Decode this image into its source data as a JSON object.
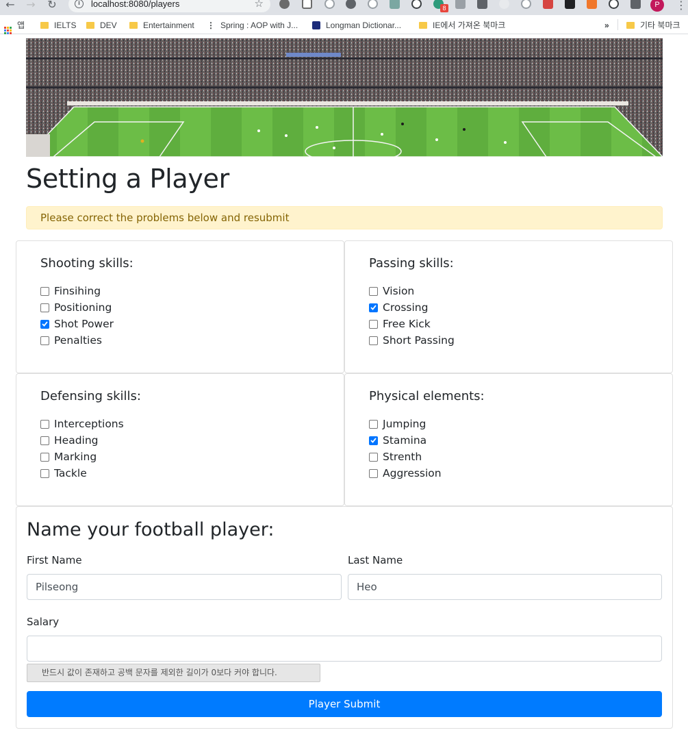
{
  "browser": {
    "url": "localhost:8080/players",
    "profile_initial": "P",
    "extension_badge": "8",
    "bookmarks": [
      {
        "label": "앱",
        "icon": "apps-icon"
      },
      {
        "label": "IELTS",
        "icon": "folder-icon"
      },
      {
        "label": "DEV",
        "icon": "folder-icon"
      },
      {
        "label": "Entertainment",
        "icon": "folder-icon"
      },
      {
        "label": "Spring : AOP with J...",
        "icon": "site-icon"
      },
      {
        "label": "Longman Dictionar...",
        "icon": "site-icon"
      },
      {
        "label": "IE에서 가져온 북마크",
        "icon": "folder-icon"
      },
      {
        "label": "기타 북마크",
        "icon": "folder-icon"
      }
    ],
    "overflow_label": "»"
  },
  "page": {
    "title": "Setting a Player",
    "alert": "Please correct the problems below and resubmit"
  },
  "skills": {
    "shooting": {
      "title": "Shooting skills:",
      "items": [
        {
          "label": "Finsihing",
          "checked": false
        },
        {
          "label": "Positioning",
          "checked": false
        },
        {
          "label": "Shot Power",
          "checked": true
        },
        {
          "label": "Penalties",
          "checked": false
        }
      ]
    },
    "passing": {
      "title": "Passing skills:",
      "items": [
        {
          "label": "Vision",
          "checked": false
        },
        {
          "label": "Crossing",
          "checked": true
        },
        {
          "label": "Free Kick",
          "checked": false
        },
        {
          "label": "Short Passing",
          "checked": false
        }
      ]
    },
    "defensing": {
      "title": "Defensing skills:",
      "items": [
        {
          "label": "Interceptions",
          "checked": false
        },
        {
          "label": "Heading",
          "checked": false
        },
        {
          "label": "Marking",
          "checked": false
        },
        {
          "label": "Tackle",
          "checked": false
        }
      ]
    },
    "physical": {
      "title": "Physical elements:",
      "items": [
        {
          "label": "Jumping",
          "checked": false
        },
        {
          "label": "Stamina",
          "checked": true
        },
        {
          "label": "Strenth",
          "checked": false
        },
        {
          "label": "Aggression",
          "checked": false
        }
      ]
    }
  },
  "form": {
    "heading": "Name your football player:",
    "first_name_label": "First Name",
    "first_name_value": "Pilseong",
    "last_name_label": "Last Name",
    "last_name_value": "Heo",
    "salary_label": "Salary",
    "salary_value": "",
    "validation_message": "반드시 값이 존재하고 공백 문자를 제외한 길이가 0보다 커야 합니다.",
    "submit_label": "Player Submit"
  },
  "colors": {
    "primary": "#007bff",
    "alert_bg": "#fff3cd",
    "alert_text": "#856404",
    "checkbox_checked": "#0075ff"
  }
}
